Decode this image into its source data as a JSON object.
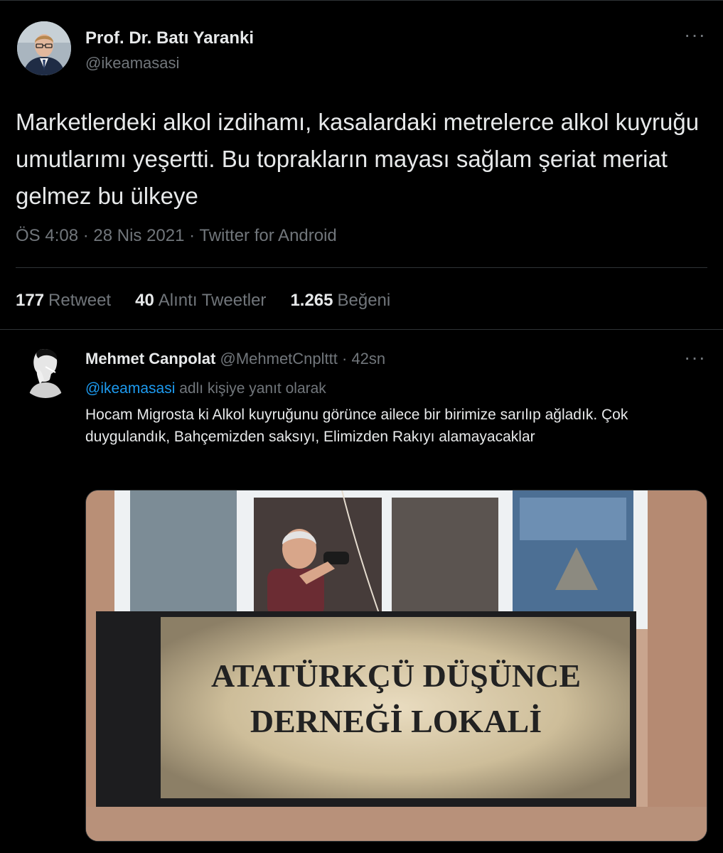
{
  "main_tweet": {
    "author_name": "Prof. Dr. Batı Yaranki",
    "author_handle": "@ikeamasasi",
    "text": "Marketlerdeki alkol izdihamı, kasalardaki metrelerce alkol kuyruğu umutlarımı yeşertti. Bu toprakların mayası sağlam şeriat meriat gelmez bu ülkeye",
    "meta": "ÖS 4:08 · 28 Nis 2021 · Twitter for Android",
    "stats": {
      "retweets_count": "177",
      "retweets_label": "Retweet",
      "quotes_count": "40",
      "quotes_label": "Alıntı Tweetler",
      "likes_count": "1.265",
      "likes_label": "Beğeni"
    }
  },
  "reply": {
    "author_name": "Mehmet Canpolat",
    "author_handle": "@MehmetCnplttt",
    "time": "· 42sn",
    "replying_mention": "@ikeamasasi",
    "replying_suffix": "adlı kişiye yanıt olarak",
    "text": "Hocam Migrosta ki Alkol kuyruğunu görünce ailece bir birimize sarılıp ağladık. Çok duygulandık, Bahçemizden saksıyı, Elimizden Rakıyı alamayacaklar",
    "photo": {
      "sign_line1": "ATATÜRKÇÜ DÜŞÜNCE",
      "sign_line2": "DERNEĞİ LOKALİ"
    }
  },
  "icons": {
    "more": "more-horizontal-icon",
    "more_glyph": "···"
  }
}
